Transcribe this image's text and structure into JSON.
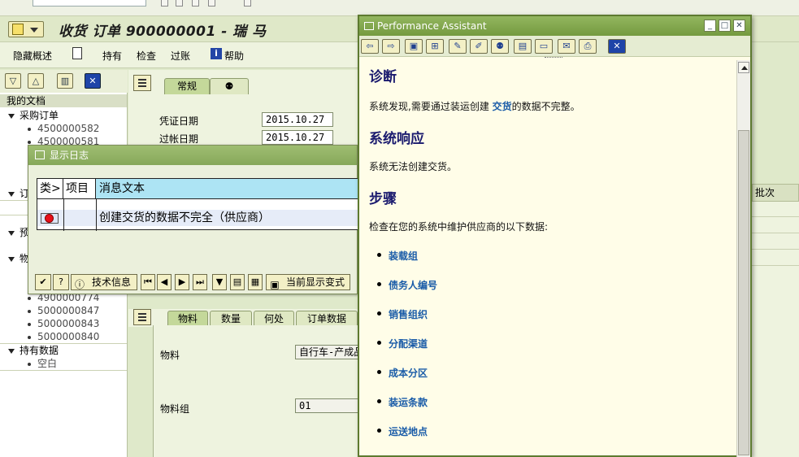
{
  "window_title": "收货 订单 900000001 - 瑞 马",
  "toolbar": {
    "hide_overview": "隐藏概述",
    "hold": "持有",
    "check": "检查",
    "post": "过账",
    "help": "帮助"
  },
  "tree": {
    "header": "我的文档",
    "nodes": [
      {
        "label": "采购订单",
        "items": [
          "4500000582",
          "4500000581"
        ]
      },
      {
        "label": "订",
        "items": []
      },
      {
        "label": "预",
        "items": []
      },
      {
        "label": "物",
        "items": [
          "4900000774",
          "5000000847",
          "5000000843",
          "5000000840"
        ]
      },
      {
        "label": "持有数据",
        "items": [
          "空白"
        ]
      }
    ]
  },
  "header_tabs": [
    "常规"
  ],
  "header_fields": [
    {
      "label": "凭证日期",
      "value": "2015.10.27"
    },
    {
      "label": "过帐日期",
      "value": "2015.10.27"
    }
  ],
  "item_tabs": [
    "物料",
    "数量",
    "何处",
    "订单数据"
  ],
  "item_fields": [
    {
      "label": "物料",
      "value": "自行车-产成品"
    },
    {
      "label": "物料组",
      "value": "01"
    }
  ],
  "grid": {
    "batch_header": "批次"
  },
  "log_dialog": {
    "title": "显示日志",
    "columns": [
      "类>",
      "项目",
      "消息文本"
    ],
    "rows": [
      {
        "type": "error",
        "item": "",
        "message": "创建交货的数据不完全（供应商）"
      }
    ],
    "buttons": {
      "tech_info": "技术信息",
      "current_layout": "当前显示变式"
    }
  },
  "perf_assistant": {
    "title": "Performance Assistant",
    "sections": {
      "diagnosis_title": "诊断",
      "diagnosis_text_before": "系统发现,需要通过装运创建 ",
      "diagnosis_keyword": "交货",
      "diagnosis_text_after": "的数据不完整。",
      "response_title": "系统响应",
      "response_text": "系统无法创建交货。",
      "steps_title": "步骤",
      "steps_text": "检查在您的系统中维护供应商的以下数据:",
      "steps": [
        "装载组",
        "债务人编号",
        "销售组织",
        "分配渠道",
        "成本分区",
        "装运条款",
        "运送地点"
      ]
    }
  },
  "colors": {
    "accent": "#1a1a6e",
    "link": "#1a5ca8",
    "caption": "#86a85a",
    "error": "#e8101a"
  }
}
